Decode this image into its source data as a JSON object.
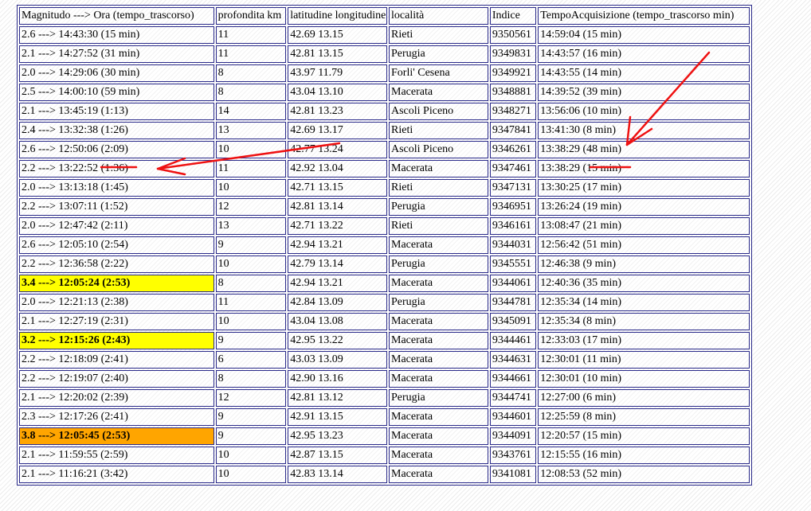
{
  "table": {
    "headers": [
      "Magnitudo ---> Ora (tempo_trascorso)",
      "profondita km",
      "latitudine longitudine",
      "località",
      "Indice",
      "TempoAcquisizione (tempo_trascorso min)"
    ],
    "rows": [
      [
        "2.6 ---> 14:43:30 (15 min)",
        "11",
        "42.69 13.15",
        "Rieti",
        "9350561",
        "14:59:04 (15 min)"
      ],
      [
        "2.1 ---> 14:27:52 (31 min)",
        "11",
        "42.81 13.15",
        "Perugia",
        "9349831",
        "14:43:57 (16 min)"
      ],
      [
        "2.0 ---> 14:29:06 (30 min)",
        "8",
        "43.97 11.79",
        "Forli' Cesena",
        "9349921",
        "14:43:55 (14 min)"
      ],
      [
        "2.5 ---> 14:00:10 (59 min)",
        "8",
        "43.04 13.10",
        "Macerata",
        "9348881",
        "14:39:52 (39 min)"
      ],
      [
        "2.1 ---> 13:45:19 (1:13)",
        "14",
        "42.81 13.23",
        "Ascoli Piceno",
        "9348271",
        "13:56:06 (10 min)"
      ],
      [
        "2.4 ---> 13:32:38 (1:26)",
        "13",
        "42.69 13.17",
        "Rieti",
        "9347841",
        "13:41:30 (8 min)"
      ],
      [
        "2.6 ---> 12:50:06 (2:09)",
        "10",
        "42.77 13.24",
        "Ascoli Piceno",
        "9346261",
        "13:38:29 (48 min)"
      ],
      [
        "2.2 ---> 13:22:52 (1:36)",
        "11",
        "42.92 13.04",
        "Macerata",
        "9347461",
        "13:38:29 (15 min)"
      ],
      [
        "2.0 ---> 13:13:18 (1:45)",
        "10",
        "42.71 13.15",
        "Rieti",
        "9347131",
        "13:30:25 (17 min)"
      ],
      [
        "2.2 ---> 13:07:11 (1:52)",
        "12",
        "42.81 13.14",
        "Perugia",
        "9346951",
        "13:26:24 (19 min)"
      ],
      [
        "2.0 ---> 12:47:42 (2:11)",
        "13",
        "42.71 13.22",
        "Rieti",
        "9346161",
        "13:08:47 (21 min)"
      ],
      [
        "2.6 ---> 12:05:10 (2:54)",
        "9",
        "42.94 13.21",
        "Macerata",
        "9344031",
        "12:56:42 (51 min)"
      ],
      [
        "2.2 ---> 12:36:58 (2:22)",
        "10",
        "42.79 13.14",
        "Perugia",
        "9345551",
        "12:46:38 (9 min)"
      ],
      [
        "3.4 ---> 12:05:24 (2:53)",
        "8",
        "42.94 13.21",
        "Macerata",
        "9344061",
        "12:40:36 (35 min)"
      ],
      [
        "2.0 ---> 12:21:13 (2:38)",
        "11",
        "42.84 13.09",
        "Perugia",
        "9344781",
        "12:35:34 (14 min)"
      ],
      [
        "2.1 ---> 12:27:19 (2:31)",
        "10",
        "43.04 13.08",
        "Macerata",
        "9345091",
        "12:35:34 (8 min)"
      ],
      [
        "3.2 ---> 12:15:26 (2:43)",
        "9",
        "42.95 13.22",
        "Macerata",
        "9344461",
        "12:33:03 (17 min)"
      ],
      [
        "2.2 ---> 12:18:09 (2:41)",
        "6",
        "43.03 13.09",
        "Macerata",
        "9344631",
        "12:30:01 (11 min)"
      ],
      [
        "2.2 ---> 12:19:07 (2:40)",
        "8",
        "42.90 13.16",
        "Macerata",
        "9344661",
        "12:30:01 (10 min)"
      ],
      [
        "2.1 ---> 12:20:02 (2:39)",
        "12",
        "42.81 13.12",
        "Perugia",
        "9344741",
        "12:27:00 (6 min)"
      ],
      [
        "2.3 ---> 12:17:26 (2:41)",
        "9",
        "42.91 13.15",
        "Macerata",
        "9344601",
        "12:25:59 (8 min)"
      ],
      [
        "3.8 ---> 12:05:45 (2:53)",
        "9",
        "42.95 13.23",
        "Macerata",
        "9344091",
        "12:20:57 (15 min)"
      ],
      [
        "2.1 ---> 11:59:55 (2:59)",
        "10",
        "42.87 13.15",
        "Macerata",
        "9343761",
        "12:15:55 (16 min)"
      ],
      [
        "2.1 ---> 11:16:21 (3:42)",
        "10",
        "42.83 13.14",
        "Macerata",
        "9341081",
        "12:08:53 (52 min)"
      ]
    ],
    "highlights": [
      {
        "row": 13,
        "color": "#ffff00"
      },
      {
        "row": 16,
        "color": "#ffff00"
      },
      {
        "row": 21,
        "color": "#ffa500"
      }
    ]
  },
  "annotations": {
    "color": "#ee1111"
  }
}
